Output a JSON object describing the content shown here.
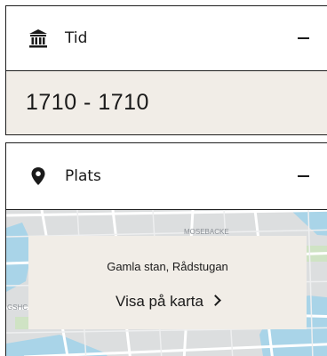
{
  "tid": {
    "icon": "museum-icon",
    "label": "Tid",
    "toggle_icon": "minus-icon",
    "date_range": "1710 - 1710"
  },
  "plats": {
    "icon": "location-pin-icon",
    "label": "Plats",
    "toggle_icon": "minus-icon",
    "map": {
      "street_label": "MOSEBACKE",
      "edge_label": "GSHC",
      "card_title": "Gamla stan, Rådstugan",
      "card_link": "Visa på karta"
    }
  },
  "colors": {
    "border": "#1e1e1e",
    "beige": "#f1ede7",
    "map_water": "#a9d4e8",
    "map_land": "#dcdedf"
  }
}
